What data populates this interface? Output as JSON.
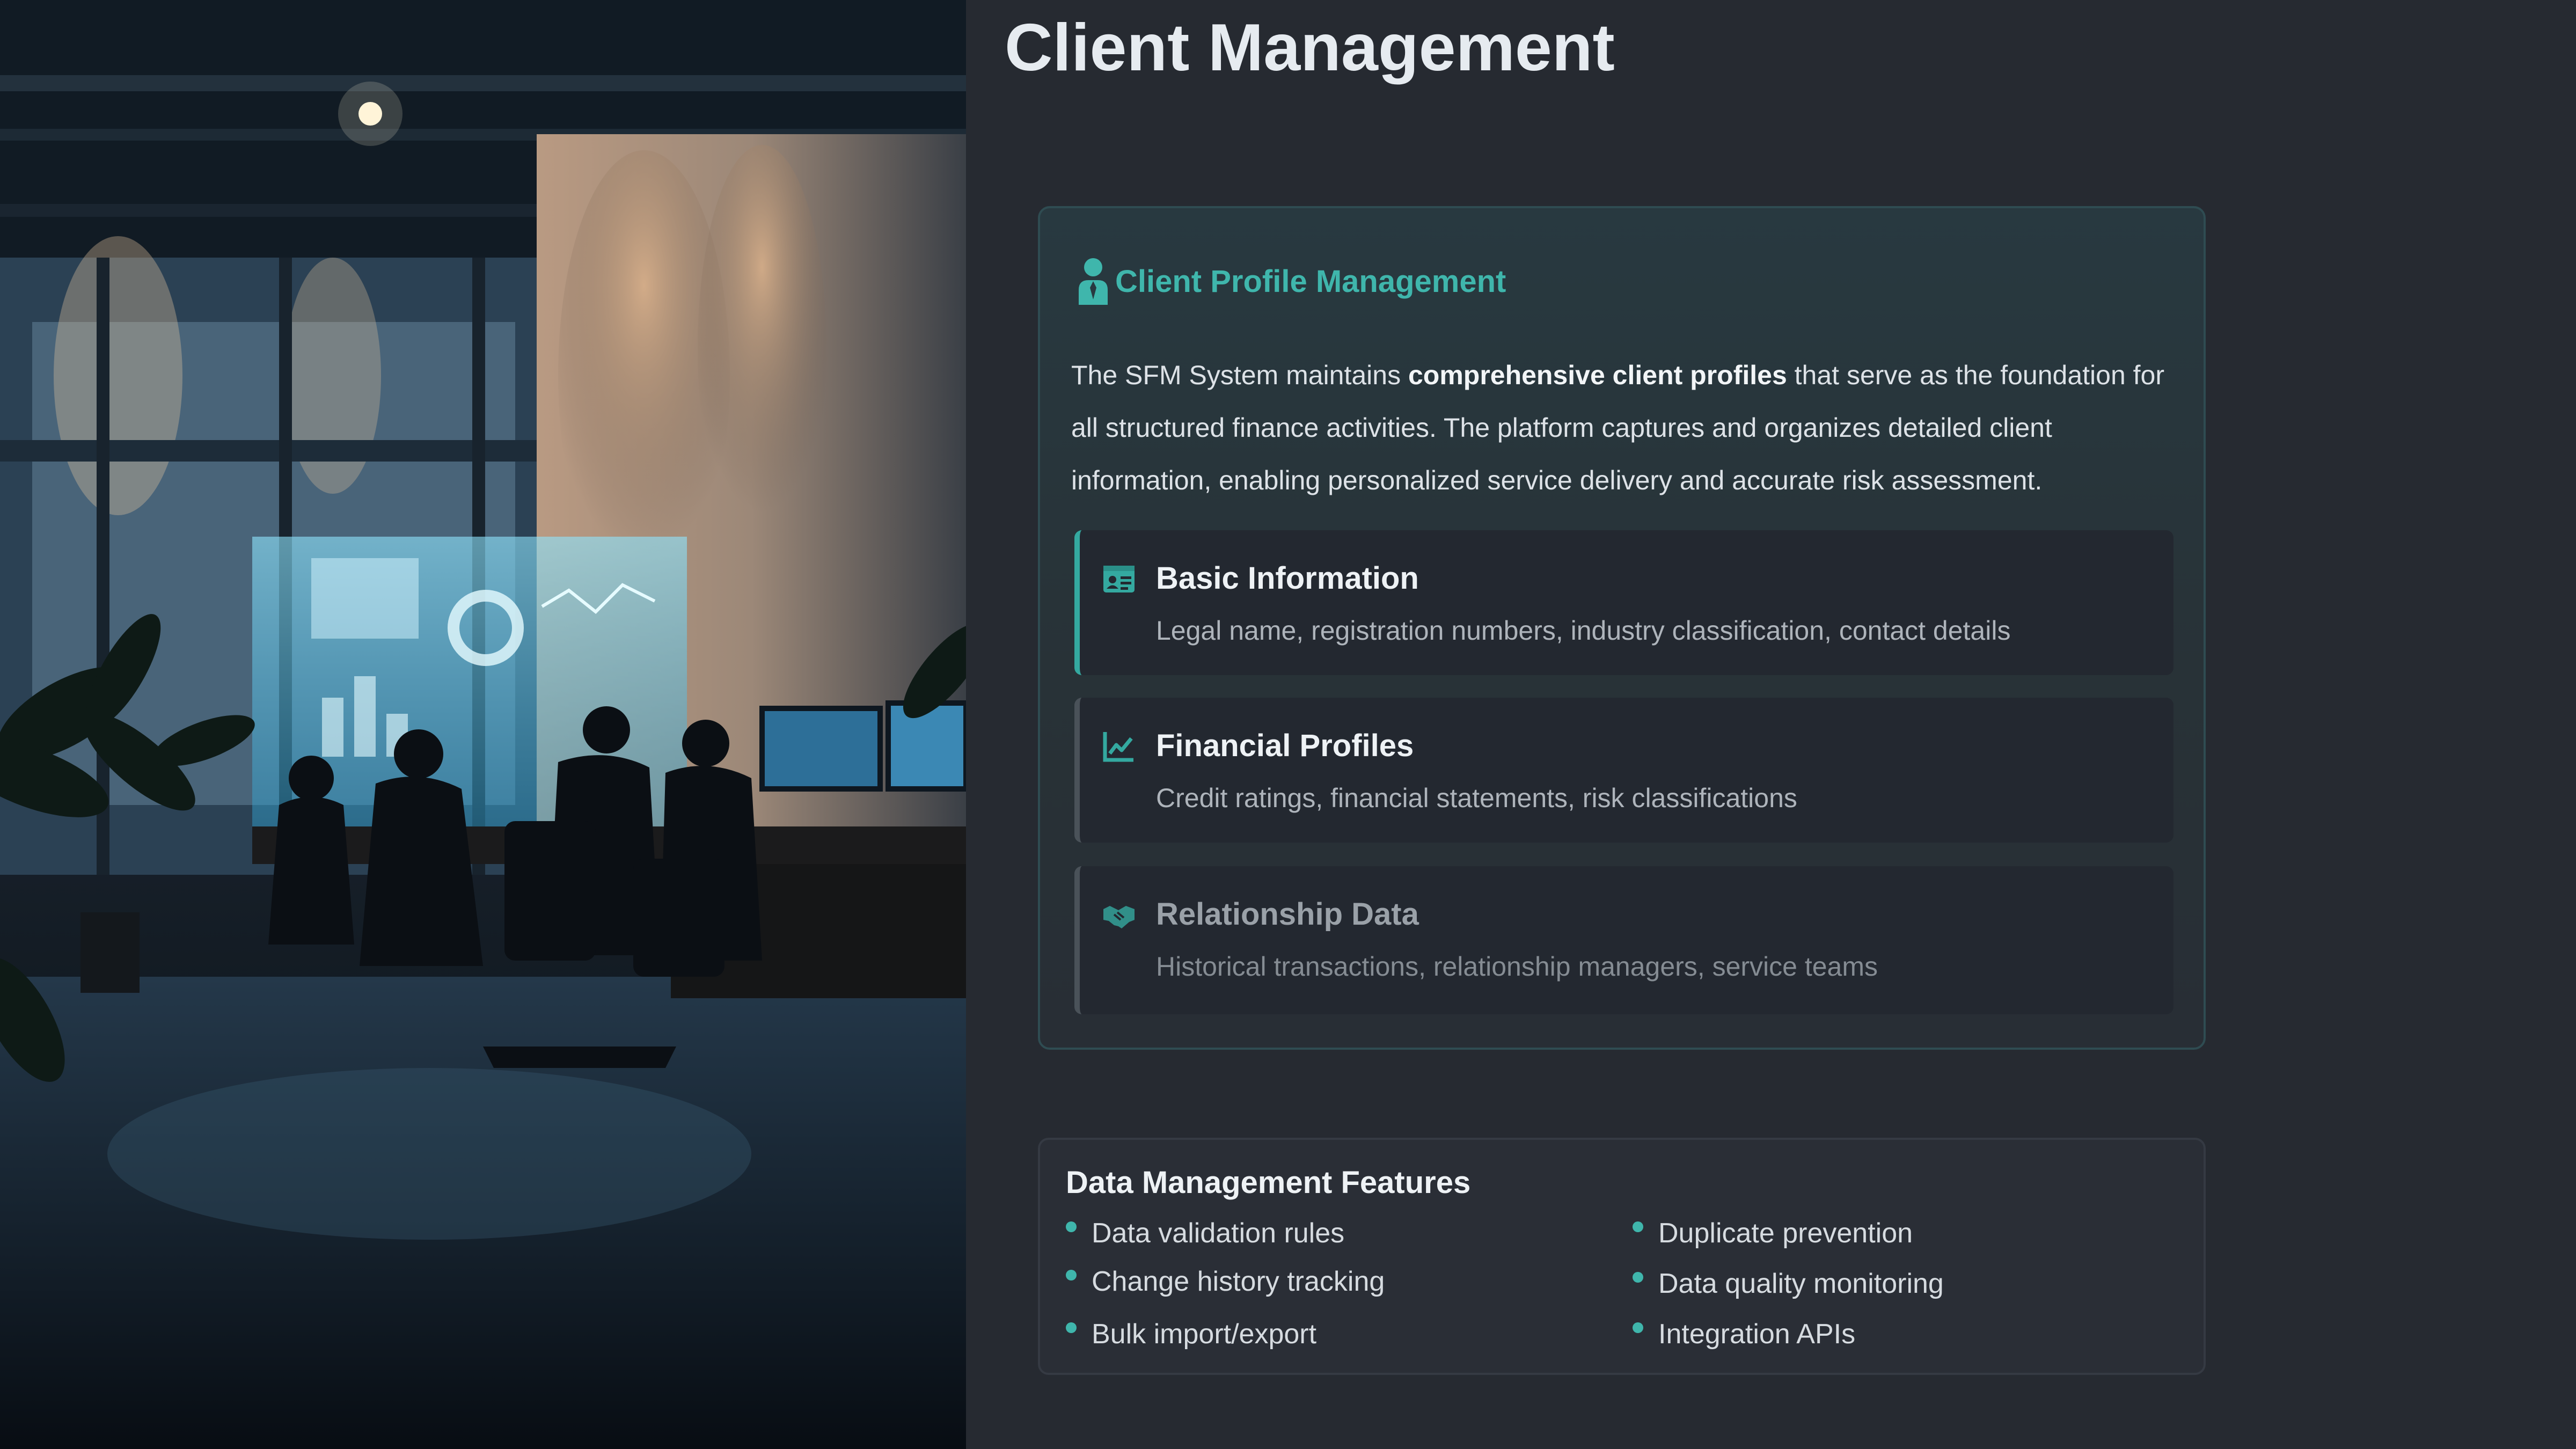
{
  "page": {
    "title": "Client Management"
  },
  "profile_card": {
    "title": "Client Profile Management",
    "intro_before": "The SFM System maintains ",
    "intro_bold": "comprehensive client profiles",
    "intro_after": " that serve as the foundation for all structured finance activities. The platform captures and organizes detailed client information, enabling personalized service delivery and accurate risk assessment.",
    "items": [
      {
        "title": "Basic Information",
        "description": "Legal name, registration numbers, industry classification, contact details",
        "icon": "id-card-icon",
        "state": "active"
      },
      {
        "title": "Financial Profiles",
        "description": "Credit ratings, financial statements, risk classifications",
        "icon": "chart-line-icon",
        "state": "normal"
      },
      {
        "title": "Relationship Data",
        "description": "Historical transactions, relationship managers, service teams",
        "icon": "handshake-icon",
        "state": "dimmed"
      }
    ]
  },
  "features": {
    "title": "Data Management Features",
    "left": [
      "Data validation rules",
      "Change history tracking",
      "Bulk import/export"
    ],
    "right": [
      "Duplicate prevention",
      "Data quality monitoring",
      "Integration APIs"
    ]
  },
  "colors": {
    "accent": "#3fb6ac",
    "background": "#262a31",
    "card_border": "#2f4c52"
  }
}
